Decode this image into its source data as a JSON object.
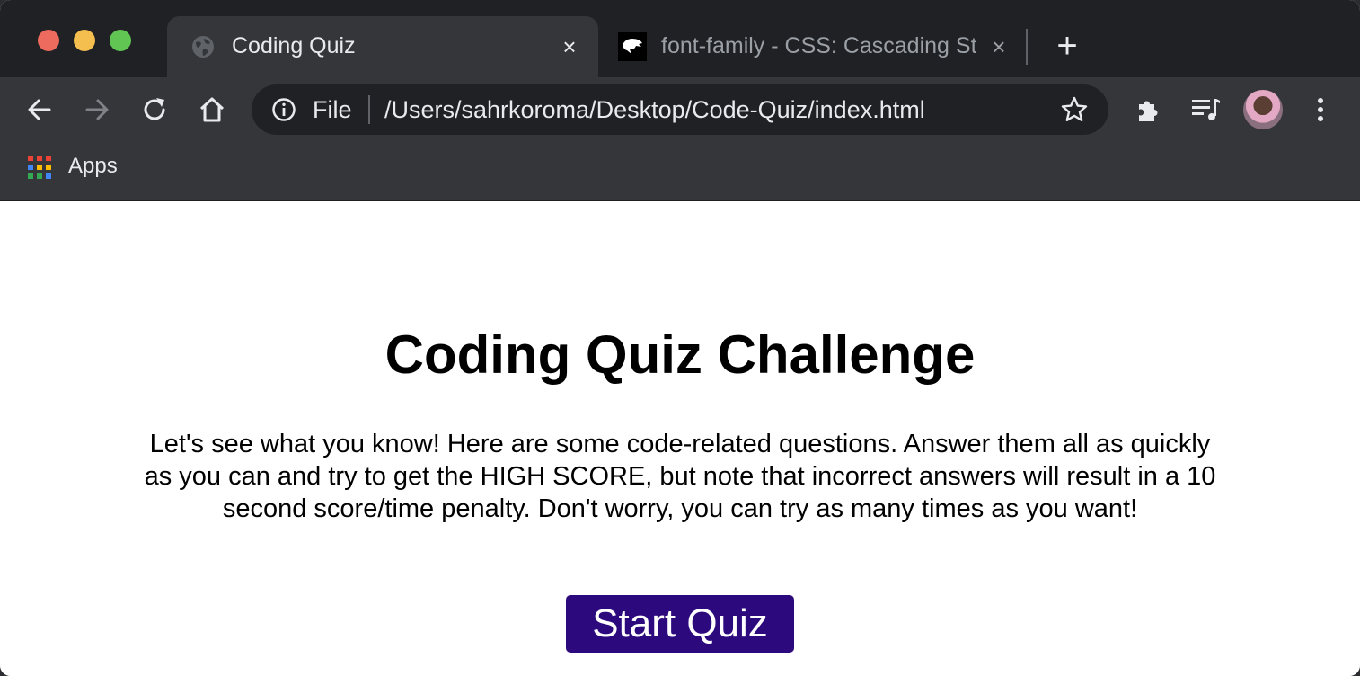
{
  "browser": {
    "tabs": [
      {
        "title": "Coding Quiz",
        "favicon": "globe-icon",
        "active": true
      },
      {
        "title": "font-family - CSS: Cascading Style Sheets | MDN",
        "favicon": "mdn-dino-icon",
        "active": false
      }
    ],
    "new_tab_label": "+",
    "close_label": "×",
    "address": {
      "scheme_label": "File",
      "url": "/Users/sahrkoroma/Desktop/Code-Quiz/index.html"
    },
    "bookmarks": [
      {
        "label": "Apps",
        "icon": "apps-grid-icon"
      }
    ],
    "toolbar_icons": [
      "back-icon",
      "forward-icon",
      "reload-icon",
      "home-icon",
      "extensions-icon",
      "media-queue-icon",
      "avatar",
      "menu-icon"
    ]
  },
  "page": {
    "heading": "Coding Quiz Challenge",
    "intro": "Let's see what you know! Here are some code-related questions. Answer them all as quickly as you can and try to get the HIGH SCORE, but note that incorrect answers will result in a 10 second score/time penalty. Don't worry, you can try as many times as you want!",
    "start_button": "Start Quiz"
  },
  "colors": {
    "tabstrip_bg": "#202124",
    "toolbar_bg": "#35363a",
    "start_button_bg": "#2c0a7e",
    "start_button_text": "#ffffff"
  }
}
